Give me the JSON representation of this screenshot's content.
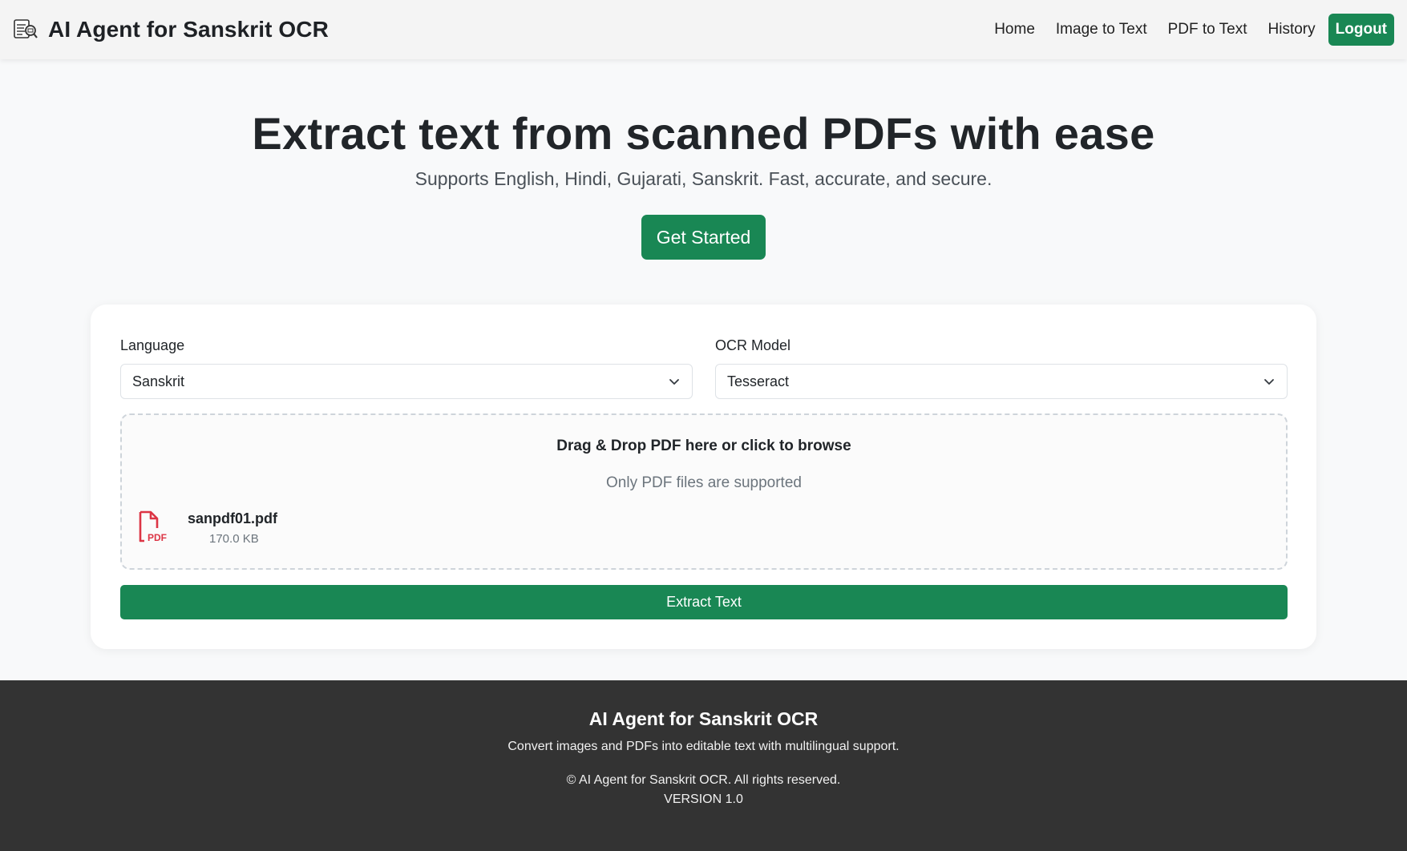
{
  "header": {
    "brand_title": "AI Agent for Sanskrit OCR",
    "brand_icon": "scanner-document-icon",
    "nav": [
      {
        "label": "Home"
      },
      {
        "label": "Image to Text"
      },
      {
        "label": "PDF to Text"
      },
      {
        "label": "History"
      }
    ],
    "logout_label": "Logout"
  },
  "hero": {
    "title": "Extract text from scanned PDFs with ease",
    "subtitle": "Supports English, Hindi, Gujarati, Sanskrit. Fast, accurate, and secure.",
    "cta_label": "Get Started"
  },
  "form": {
    "language": {
      "label": "Language",
      "value": "Sanskrit"
    },
    "ocr_model": {
      "label": "OCR Model",
      "value": "Tesseract"
    },
    "dropzone": {
      "title": "Drag & Drop PDF here or click to browse",
      "hint": "Only PDF files are supported"
    },
    "file": {
      "icon": "pdf-file-icon",
      "icon_text": "PDF",
      "name": "sanpdf01.pdf",
      "size": "170.0 KB"
    },
    "submit_label": "Extract Text"
  },
  "footer": {
    "title": "AI Agent for Sanskrit OCR",
    "description": "Convert images and PDFs into editable text with multilingual support.",
    "copyright": "© AI Agent for Sanskrit OCR. All rights reserved.",
    "version": "VERSION 1.0"
  },
  "colors": {
    "primary": "#198754",
    "footer_bg": "#333333",
    "pdf_red": "#dc3545"
  }
}
